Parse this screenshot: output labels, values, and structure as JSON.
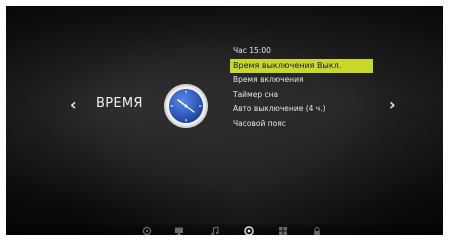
{
  "section": {
    "title": "ВРЕМЯ",
    "left_arrow": "‹",
    "right_arrow": "›"
  },
  "menu": {
    "items": [
      {
        "label": "Час 15:00"
      },
      {
        "label": "Время выключения Выкл."
      },
      {
        "label": "Время включения"
      },
      {
        "label": "Таймер сна"
      },
      {
        "label": "Авто выключение (4 ч.)"
      },
      {
        "label": "Часовой пояс"
      }
    ],
    "selected_index": 1
  },
  "bottom_nav": {
    "items": [
      "picture-icon",
      "screen-icon",
      "music-icon",
      "clock-icon",
      "grid-icon",
      "lock-icon"
    ],
    "active": "clock-icon"
  },
  "colors": {
    "highlight": "#c8d72a",
    "clock_face": "#2a5bc8"
  }
}
